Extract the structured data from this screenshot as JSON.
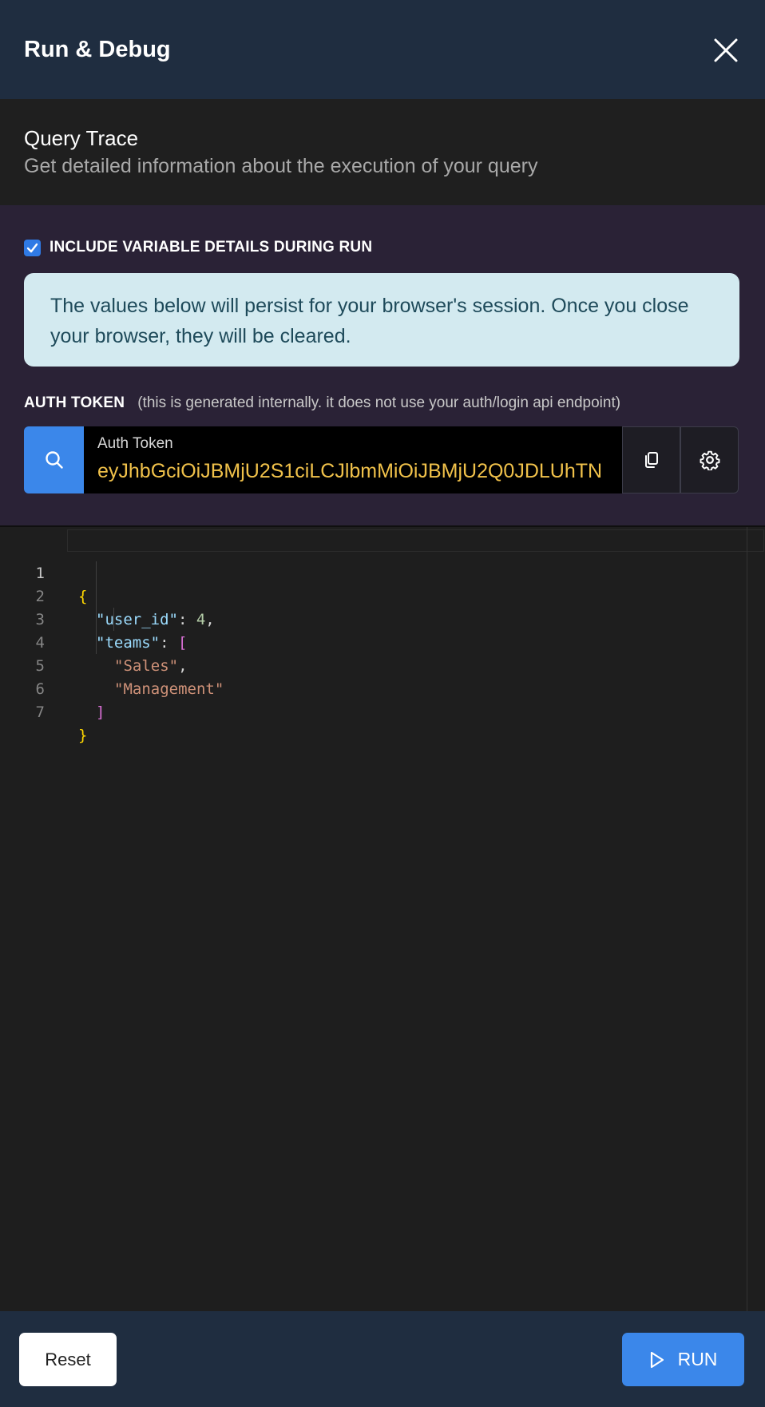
{
  "header": {
    "title": "Run & Debug"
  },
  "trace": {
    "title": "Query Trace",
    "subtitle": "Get detailed information about the execution of your query"
  },
  "variables": {
    "include_label": "INCLUDE VARIABLE DETAILS DURING RUN",
    "include_checked": true,
    "info_text": "The values below will persist for your browser's session. Once you close your browser, they will be cleared.",
    "auth_label": "AUTH TOKEN",
    "auth_hint": "(this is generated internally. it does not use your auth/login api endpoint)",
    "token_field_label": "Auth Token",
    "token_value": "eyJhbGciOiJBMjU2S1ciLCJlbmMiOiJBMjU2Q0JDLUhTN"
  },
  "editor": {
    "line_numbers": [
      "1",
      "2",
      "3",
      "4",
      "5",
      "6",
      "7"
    ],
    "active_line": "1",
    "json_keys": {
      "user_id": "\"user_id\"",
      "teams": "\"teams\""
    },
    "json_values": {
      "user_id": "4",
      "team_1": "\"Sales\"",
      "team_2": "\"Management\""
    }
  },
  "footer": {
    "reset_label": "Reset",
    "run_label": "RUN"
  },
  "colors": {
    "header_bg": "#1f2d40",
    "accent_blue": "#3b87ea",
    "token_yellow": "#f0c14a",
    "info_bg": "#d3eaf0"
  }
}
